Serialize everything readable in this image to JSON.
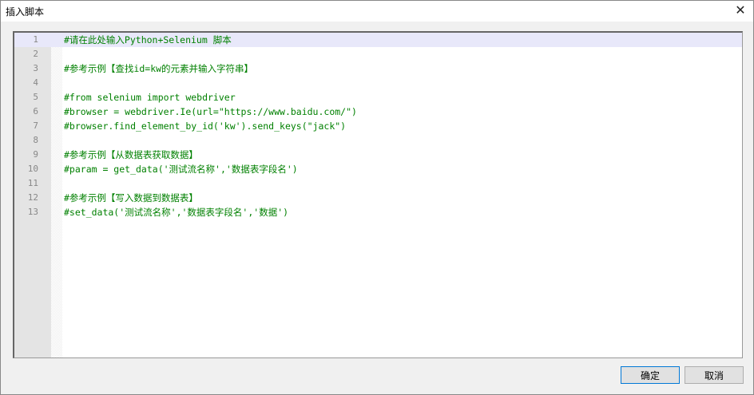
{
  "window": {
    "title": "插入脚本",
    "close_icon": "close-icon"
  },
  "editor": {
    "lines": [
      "#请在此处输入Python+Selenium 脚本",
      "",
      "#参考示例【查找id=kw的元素并输入字符串】",
      "",
      "#from selenium import webdriver",
      "#browser = webdriver.Ie(url=\"https://www.baidu.com/\")",
      "#browser.find_element_by_id('kw').send_keys(\"jack\")",
      "",
      "#参考示例【从数据表获取数据】",
      "#param = get_data('测试流名称','数据表字段名')",
      "",
      "#参考示例【写入数据到数据表】",
      "#set_data('测试流名称','数据表字段名','数据')"
    ],
    "line_numbers": [
      "1",
      "2",
      "3",
      "4",
      "5",
      "6",
      "7",
      "8",
      "9",
      "10",
      "11",
      "12",
      "13"
    ]
  },
  "buttons": {
    "ok": "确定",
    "cancel": "取消"
  }
}
